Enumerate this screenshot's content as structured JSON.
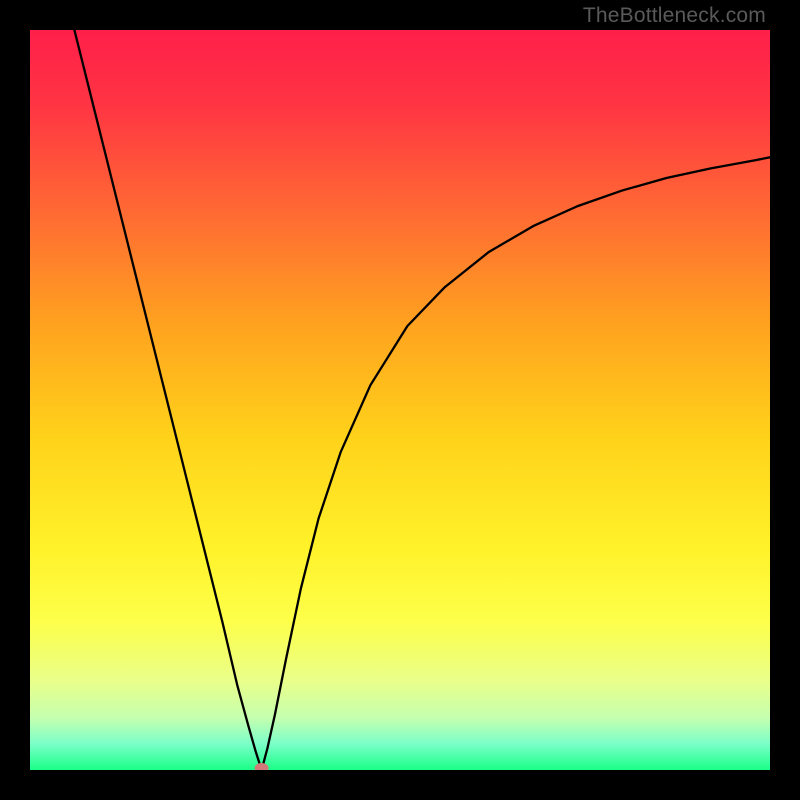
{
  "watermark": "TheBottleneck.com",
  "chart_data": {
    "type": "line",
    "title": "",
    "xlabel": "",
    "ylabel": "",
    "xlim": [
      0,
      1
    ],
    "ylim": [
      0,
      1
    ],
    "gradient_stops": [
      {
        "offset": 0.0,
        "color": "#ff1f4a"
      },
      {
        "offset": 0.1,
        "color": "#ff3443"
      },
      {
        "offset": 0.25,
        "color": "#ff6b33"
      },
      {
        "offset": 0.4,
        "color": "#ffa31f"
      },
      {
        "offset": 0.55,
        "color": "#ffd21a"
      },
      {
        "offset": 0.7,
        "color": "#fff22a"
      },
      {
        "offset": 0.8,
        "color": "#fdff4a"
      },
      {
        "offset": 0.88,
        "color": "#e9ff8a"
      },
      {
        "offset": 0.93,
        "color": "#c4ffb0"
      },
      {
        "offset": 0.965,
        "color": "#7affc8"
      },
      {
        "offset": 1.0,
        "color": "#19ff87"
      }
    ],
    "minimum_marker": {
      "x": 0.313,
      "y": 0.0,
      "color": "#d07a7a"
    },
    "series": [
      {
        "name": "curve",
        "x": [
          0.06,
          0.08,
          0.1,
          0.12,
          0.14,
          0.16,
          0.18,
          0.2,
          0.22,
          0.24,
          0.26,
          0.28,
          0.295,
          0.305,
          0.313,
          0.321,
          0.331,
          0.346,
          0.366,
          0.39,
          0.42,
          0.46,
          0.51,
          0.56,
          0.62,
          0.68,
          0.74,
          0.8,
          0.86,
          0.92,
          0.98,
          1.0
        ],
        "y": [
          1.0,
          0.92,
          0.84,
          0.76,
          0.68,
          0.6,
          0.52,
          0.44,
          0.36,
          0.28,
          0.2,
          0.115,
          0.06,
          0.025,
          0.0,
          0.03,
          0.075,
          0.15,
          0.245,
          0.34,
          0.43,
          0.52,
          0.6,
          0.652,
          0.7,
          0.735,
          0.762,
          0.783,
          0.8,
          0.813,
          0.824,
          0.828
        ]
      }
    ]
  }
}
